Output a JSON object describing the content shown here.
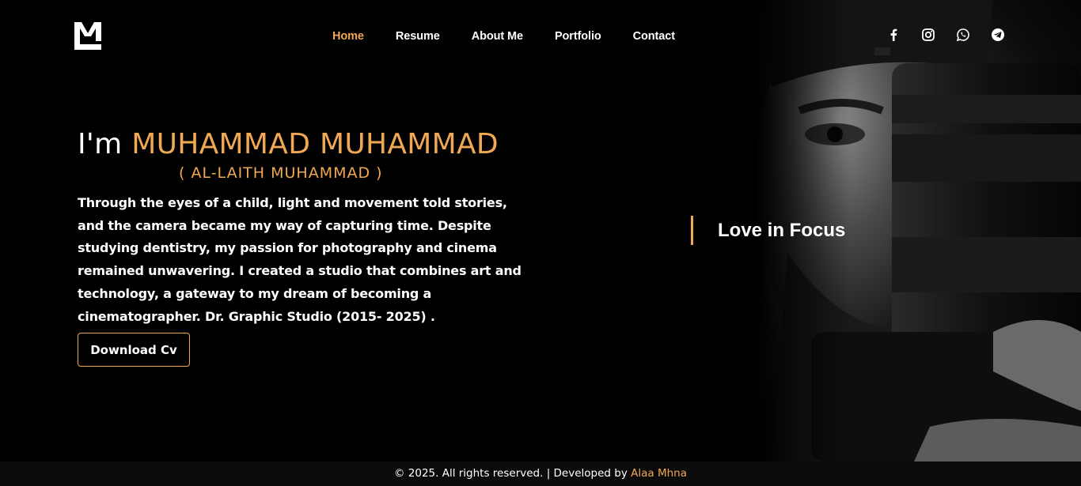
{
  "header": {
    "logo_alt": "M logo",
    "nav": [
      {
        "label": "Home",
        "active": true
      },
      {
        "label": "Resume",
        "active": false
      },
      {
        "label": "About Me",
        "active": false
      },
      {
        "label": "Portfolio",
        "active": false
      },
      {
        "label": "Contact",
        "active": false
      }
    ],
    "socials": [
      "facebook-icon",
      "instagram-icon",
      "whatsapp-icon",
      "telegram-icon"
    ]
  },
  "hero": {
    "greeting": "I'm",
    "name": "MUHAMMAD MUHAMMAD",
    "subtitle": "( AL-LAITH MUHAMMAD )",
    "bio": "Through the eyes of a child, light and movement told stories, and the camera became my way of capturing time. Despite studying dentistry, my passion for photography and cinema remained unwavering. I created a studio that combines art and technology, a gateway to my dream of becoming a cinematographer. Dr. Graphic Studio (2015- 2025) .",
    "cv_button": "Download Cv",
    "tagline": "Love in Focus"
  },
  "footer": {
    "copyright": "© 2025. All rights reserved. | Developed by ",
    "developer": "Alaa Mhna"
  },
  "colors": {
    "accent": "#f0a854",
    "background": "#000000",
    "footer_bg": "#0b0b0b"
  }
}
